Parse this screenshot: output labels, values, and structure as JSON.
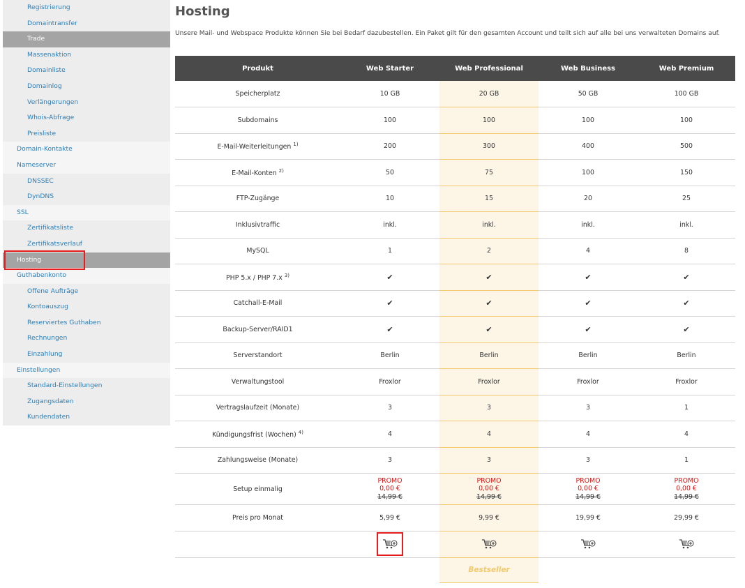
{
  "sidebar": {
    "items": [
      {
        "label": "Registrierung"
      },
      {
        "label": "Domaintransfer"
      },
      {
        "label": "Trade"
      },
      {
        "label": "Massenaktion"
      },
      {
        "label": "Domainliste"
      },
      {
        "label": "Domainlog"
      },
      {
        "label": "Verlängerungen"
      },
      {
        "label": "Whois-Abfrage"
      },
      {
        "label": "Preisliste"
      },
      {
        "label": "Domain-Kontakte"
      },
      {
        "label": "Nameserver"
      },
      {
        "label": "DNSSEC"
      },
      {
        "label": "DynDNS"
      },
      {
        "label": "SSL"
      },
      {
        "label": "Zertifikatsliste"
      },
      {
        "label": "Zertifikatsverlauf"
      },
      {
        "label": "Hosting"
      },
      {
        "label": "Guthabenkonto"
      },
      {
        "label": "Offene Aufträge"
      },
      {
        "label": "Kontoauszug"
      },
      {
        "label": "Reserviertes Guthaben"
      },
      {
        "label": "Rechnungen"
      },
      {
        "label": "Einzahlung"
      },
      {
        "label": "Einstellungen"
      },
      {
        "label": "Standard-Einstellungen"
      },
      {
        "label": "Zugangsdaten"
      },
      {
        "label": "Kundendaten"
      }
    ]
  },
  "page": {
    "title": "Hosting",
    "intro": "Unsere Mail- und Webspace Produkte können Sie bei Bedarf dazubestellen. Ein Paket gilt für den gesamten Account und teilt sich auf alle bei uns verwalteten Domains auf."
  },
  "table": {
    "headers": [
      "Produkt",
      "Web Starter",
      "Web Professional",
      "Web Business",
      "Web Premium"
    ],
    "rows": [
      {
        "label": "Speicherplatz",
        "sup": "",
        "values": [
          "10 GB",
          "20 GB",
          "50 GB",
          "100 GB"
        ]
      },
      {
        "label": "Subdomains",
        "sup": "",
        "values": [
          "100",
          "100",
          "100",
          "100"
        ]
      },
      {
        "label": "E-Mail-Weiterleitungen",
        "sup": "1)",
        "values": [
          "200",
          "300",
          "400",
          "500"
        ]
      },
      {
        "label": "E-Mail-Konten",
        "sup": "2)",
        "values": [
          "50",
          "75",
          "100",
          "150"
        ]
      },
      {
        "label": "FTP-Zugänge",
        "sup": "",
        "values": [
          "10",
          "15",
          "20",
          "25"
        ]
      },
      {
        "label": "Inklusivtraffic",
        "sup": "",
        "values": [
          "inkl.",
          "inkl.",
          "inkl.",
          "inkl."
        ]
      },
      {
        "label": "MySQL",
        "sup": "",
        "values": [
          "1",
          "2",
          "4",
          "8"
        ]
      },
      {
        "label": "PHP 5.x / PHP 7.x",
        "sup": "3)",
        "values": [
          "✔",
          "✔",
          "✔",
          "✔"
        ]
      },
      {
        "label": "Catchall-E-Mail",
        "sup": "",
        "values": [
          "✔",
          "✔",
          "✔",
          "✔"
        ]
      },
      {
        "label": "Backup-Server/RAID1",
        "sup": "",
        "values": [
          "✔",
          "✔",
          "✔",
          "✔"
        ]
      },
      {
        "label": "Serverstandort",
        "sup": "",
        "values": [
          "Berlin",
          "Berlin",
          "Berlin",
          "Berlin"
        ]
      },
      {
        "label": "Verwaltungstool",
        "sup": "",
        "values": [
          "Froxlor",
          "Froxlor",
          "Froxlor",
          "Froxlor"
        ]
      },
      {
        "label": "Vertragslaufzeit (Monate)",
        "sup": "",
        "values": [
          "3",
          "3",
          "3",
          "1"
        ]
      },
      {
        "label": "Kündigungsfrist (Wochen)",
        "sup": "4)",
        "values": [
          "4",
          "4",
          "4",
          "4"
        ]
      },
      {
        "label": "Zahlungsweise (Monate)",
        "sup": "",
        "values": [
          "3",
          "3",
          "3",
          "1"
        ]
      }
    ],
    "setup": {
      "label": "Setup einmalig",
      "promo": "PROMO",
      "new_price": "0,00 €",
      "old_price": "14,99 €"
    },
    "price": {
      "label": "Preis pro Monat",
      "values": [
        "5,99 €",
        "9,99 €",
        "19,99 €",
        "29,99 €"
      ]
    },
    "cart_icon": "cart-add-icon",
    "bestseller": "Bestseller"
  },
  "colors": {
    "link": "#2a7fb8",
    "header_bg": "#4a4a4a",
    "highlight_col": "#fdf6e7",
    "highlight_border": "#f2c96d",
    "promo": "#d51515",
    "annotation": "#e41c1c"
  }
}
